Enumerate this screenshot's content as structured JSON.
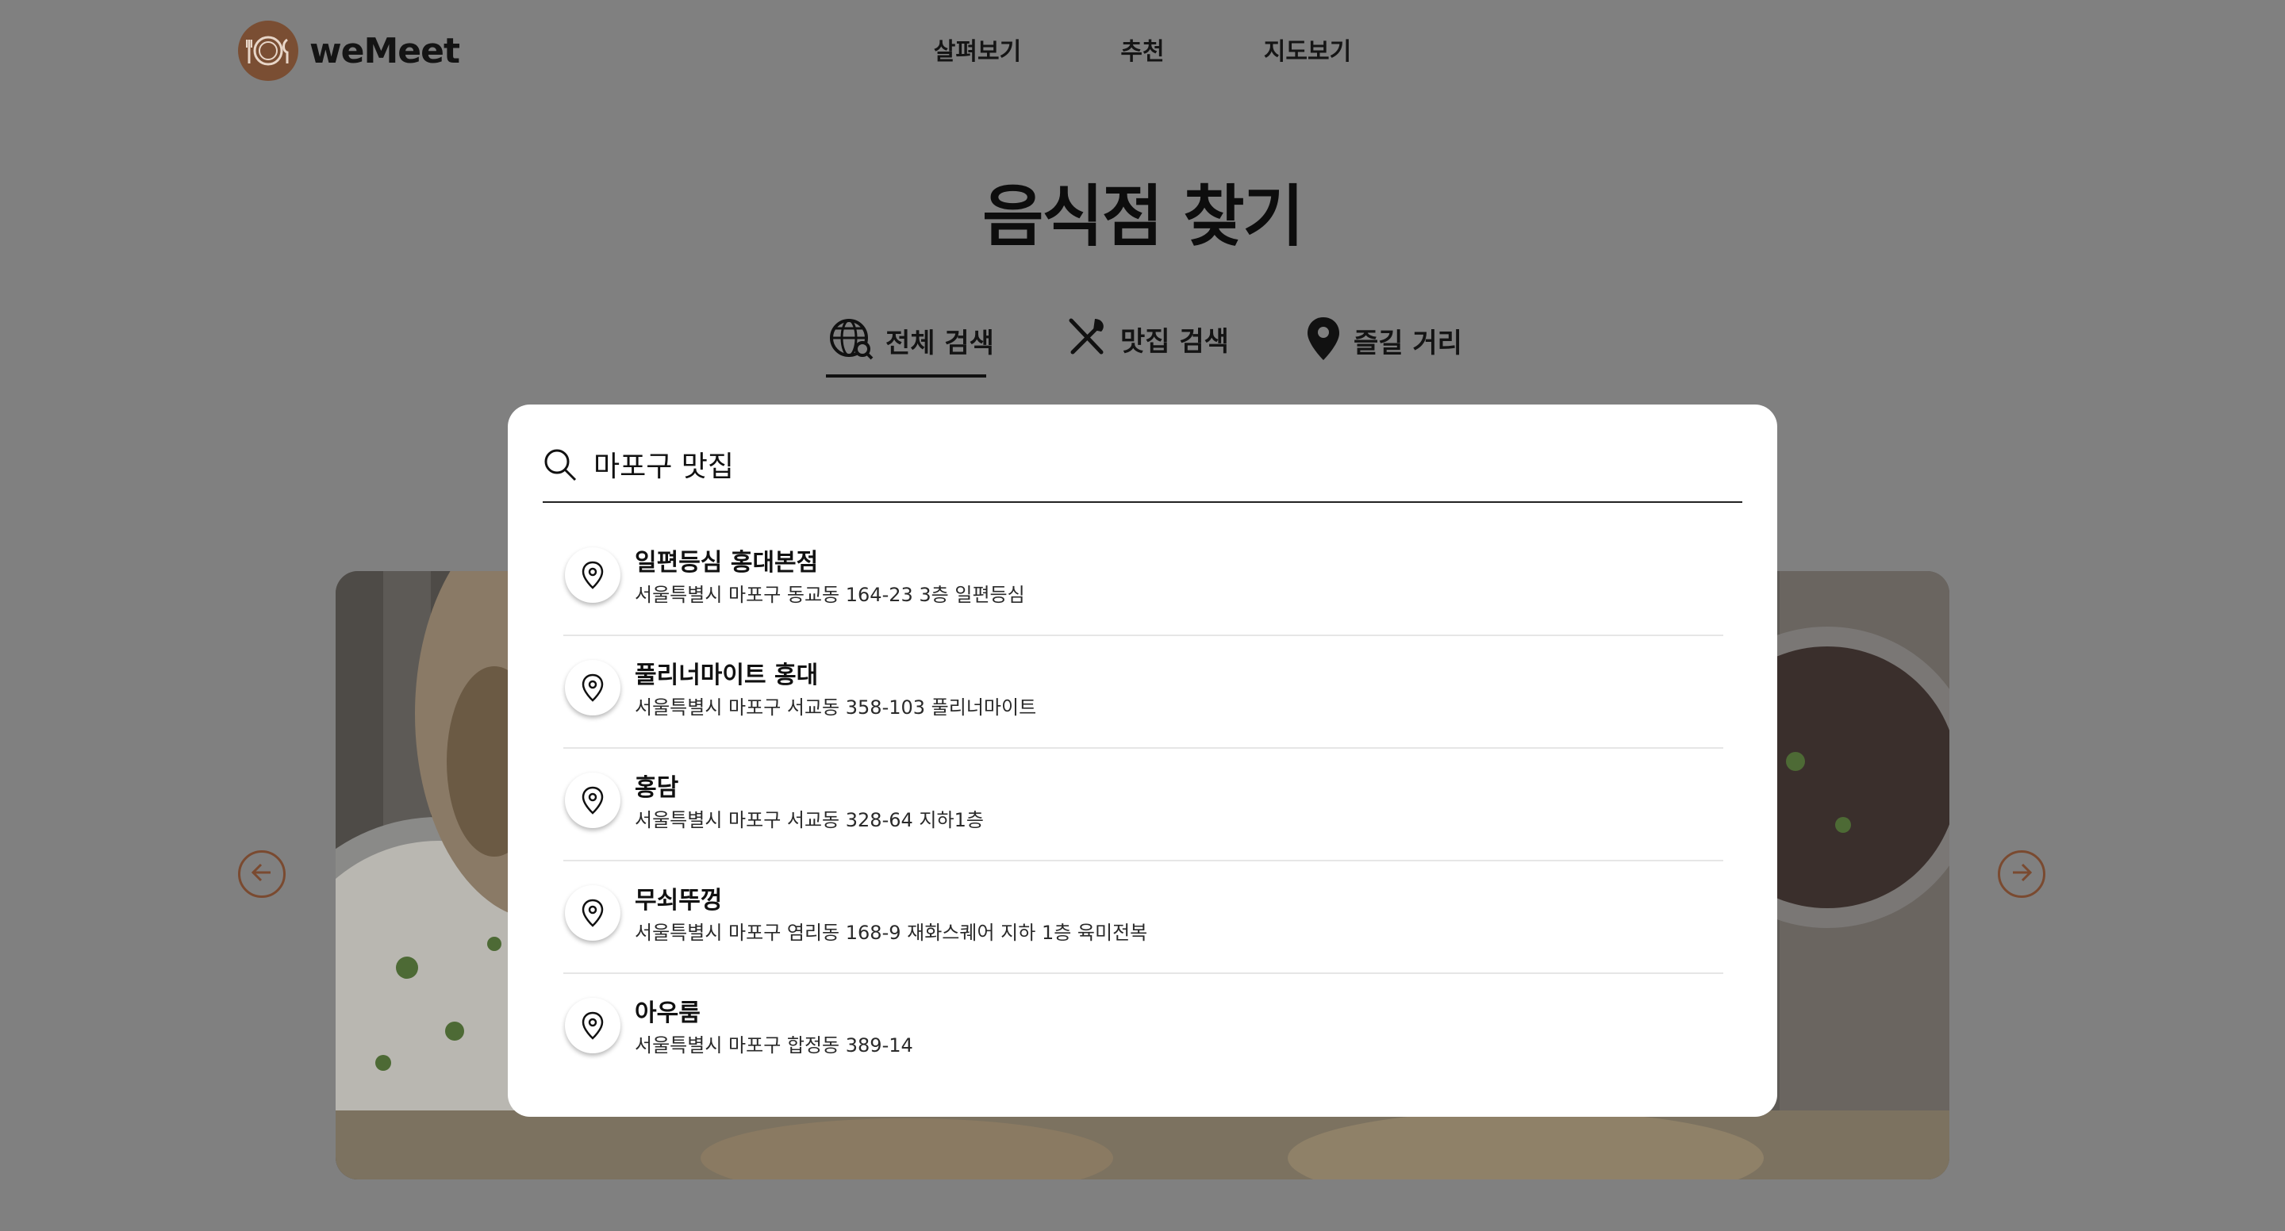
{
  "header": {
    "logo_text": "weMeet",
    "nav": [
      "살펴보기",
      "추천",
      "지도보기"
    ]
  },
  "page_title": "음식점 찾기",
  "tabs": [
    {
      "label": "전체 검색",
      "icon": "globe-search-icon",
      "active": true
    },
    {
      "label": "맛집 검색",
      "icon": "utensils-icon",
      "active": false
    },
    {
      "label": "즐길 거리",
      "icon": "map-pin-icon",
      "active": false
    }
  ],
  "search": {
    "value": "마포구 맛집",
    "placeholder": ""
  },
  "results": [
    {
      "name": "일편등심 홍대본점",
      "address": "서울특별시 마포구 동교동 164-23 3층 일편등심"
    },
    {
      "name": "풀리너마이트 홍대",
      "address": "서울특별시 마포구 서교동 358-103 풀리너마이트"
    },
    {
      "name": "홍담",
      "address": "서울특별시 마포구 서교동 328-64 지하1층"
    },
    {
      "name": "무쇠뚜껑",
      "address": "서울특별시 마포구 염리동 168-9 재화스퀘어 지하 1층 육미전복"
    },
    {
      "name": "아우룸",
      "address": "서울특별시 마포구 합정동 389-14"
    }
  ],
  "colors": {
    "overlay": "#808080",
    "brand": "#7a4e33",
    "panel": "#ffffff",
    "text": "#111111"
  }
}
